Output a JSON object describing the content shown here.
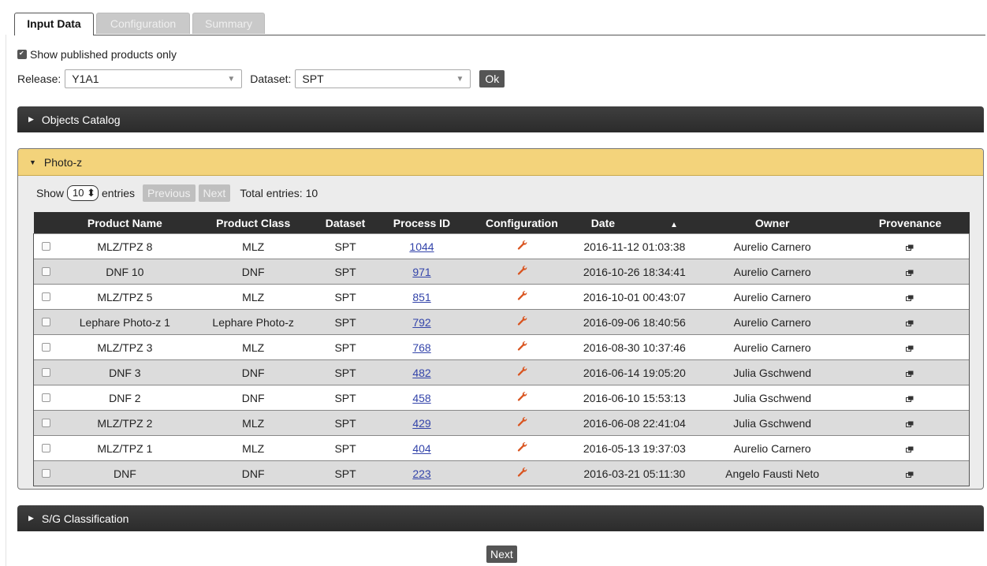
{
  "tabs": [
    "Input Data",
    "Configuration",
    "Summary"
  ],
  "filters": {
    "published_only_label": "Show published products only",
    "published_only_checked": true,
    "release_label": "Release:",
    "release_value": "Y1A1",
    "dataset_label": "Dataset:",
    "dataset_value": "SPT",
    "ok_label": "Ok"
  },
  "sections": {
    "objects_catalog": "Objects Catalog",
    "photoz": "Photo-z",
    "sg": "S/G Classification"
  },
  "table_controls": {
    "show": "Show",
    "page_size": "10",
    "entries": "entries",
    "previous": "Previous",
    "next": "Next",
    "total": "Total entries: 10"
  },
  "columns": [
    "Product Name",
    "Product Class",
    "Dataset",
    "Process ID",
    "Configuration",
    "Date",
    "Owner",
    "Provenance"
  ],
  "rows": [
    {
      "name": "MLZ/TPZ 8",
      "class": "MLZ",
      "dataset": "SPT",
      "pid": "1044",
      "date": "2016-11-12 01:03:38",
      "owner": "Aurelio Carnero"
    },
    {
      "name": "DNF 10",
      "class": "DNF",
      "dataset": "SPT",
      "pid": "971",
      "date": "2016-10-26 18:34:41",
      "owner": "Aurelio Carnero"
    },
    {
      "name": "MLZ/TPZ 5",
      "class": "MLZ",
      "dataset": "SPT",
      "pid": "851",
      "date": "2016-10-01 00:43:07",
      "owner": "Aurelio Carnero"
    },
    {
      "name": "Lephare Photo-z 1",
      "class": "Lephare Photo-z",
      "dataset": "SPT",
      "pid": "792",
      "date": "2016-09-06 18:40:56",
      "owner": "Aurelio Carnero"
    },
    {
      "name": "MLZ/TPZ 3",
      "class": "MLZ",
      "dataset": "SPT",
      "pid": "768",
      "date": "2016-08-30 10:37:46",
      "owner": "Aurelio Carnero"
    },
    {
      "name": "DNF 3",
      "class": "DNF",
      "dataset": "SPT",
      "pid": "482",
      "date": "2016-06-14 19:05:20",
      "owner": "Julia Gschwend"
    },
    {
      "name": "DNF 2",
      "class": "DNF",
      "dataset": "SPT",
      "pid": "458",
      "date": "2016-06-10 15:53:13",
      "owner": "Julia Gschwend"
    },
    {
      "name": "MLZ/TPZ 2",
      "class": "MLZ",
      "dataset": "SPT",
      "pid": "429",
      "date": "2016-06-08 22:41:04",
      "owner": "Julia Gschwend"
    },
    {
      "name": "MLZ/TPZ 1",
      "class": "MLZ",
      "dataset": "SPT",
      "pid": "404",
      "date": "2016-05-13 19:37:03",
      "owner": "Aurelio Carnero"
    },
    {
      "name": "DNF",
      "class": "DNF",
      "dataset": "SPT",
      "pid": "223",
      "date": "2016-03-21 05:11:30",
      "owner": "Angelo Fausti Neto"
    }
  ],
  "footer": {
    "next": "Next"
  },
  "icons": {
    "configuration": "wrench-icon",
    "provenance": "external-link-icon",
    "sort": "sort-asc-icon"
  },
  "colors": {
    "photoz_header": "#f3d37b",
    "dark_bar": "#2e2e2e",
    "wrench": "#d9531e",
    "link": "#3344aa"
  }
}
